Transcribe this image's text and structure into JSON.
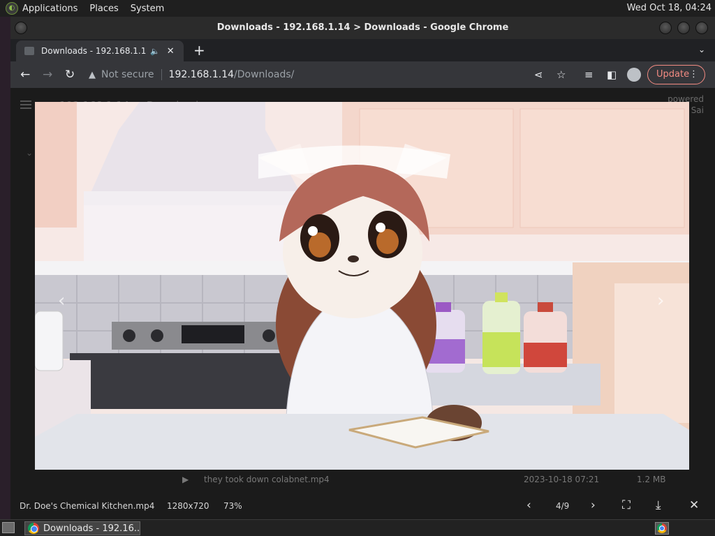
{
  "top_panel": {
    "menus": [
      "Applications",
      "Places",
      "System"
    ],
    "clock": "Wed Oct 18, 04:24"
  },
  "window": {
    "title": "Downloads - 192.168.1.14 > Downloads - Google Chrome"
  },
  "tab": {
    "title": "Downloads - 192.168.1.14",
    "audio_icon": "speaker-icon"
  },
  "omnibox": {
    "security_label": "Not secure",
    "host": "192.168.1.14",
    "path": "/Downloads/"
  },
  "toolbar": {
    "update_label": "Update"
  },
  "page_background": {
    "header_text": "192.168.1.14 — Downloads",
    "powered_line1": "powered",
    "powered_line2": "Sai",
    "row": {
      "name": "they took down colabnet.mp4",
      "date": "2023-10-18 07:21",
      "size": "1.2 MB"
    }
  },
  "lightbox": {
    "filename": "Dr. Doe's Chemical Kitchen.mp4",
    "resolution": "1280x720",
    "zoom": "73%",
    "counter": "4/9"
  },
  "taskbar": {
    "task_label": "Downloads - 192.16..."
  }
}
